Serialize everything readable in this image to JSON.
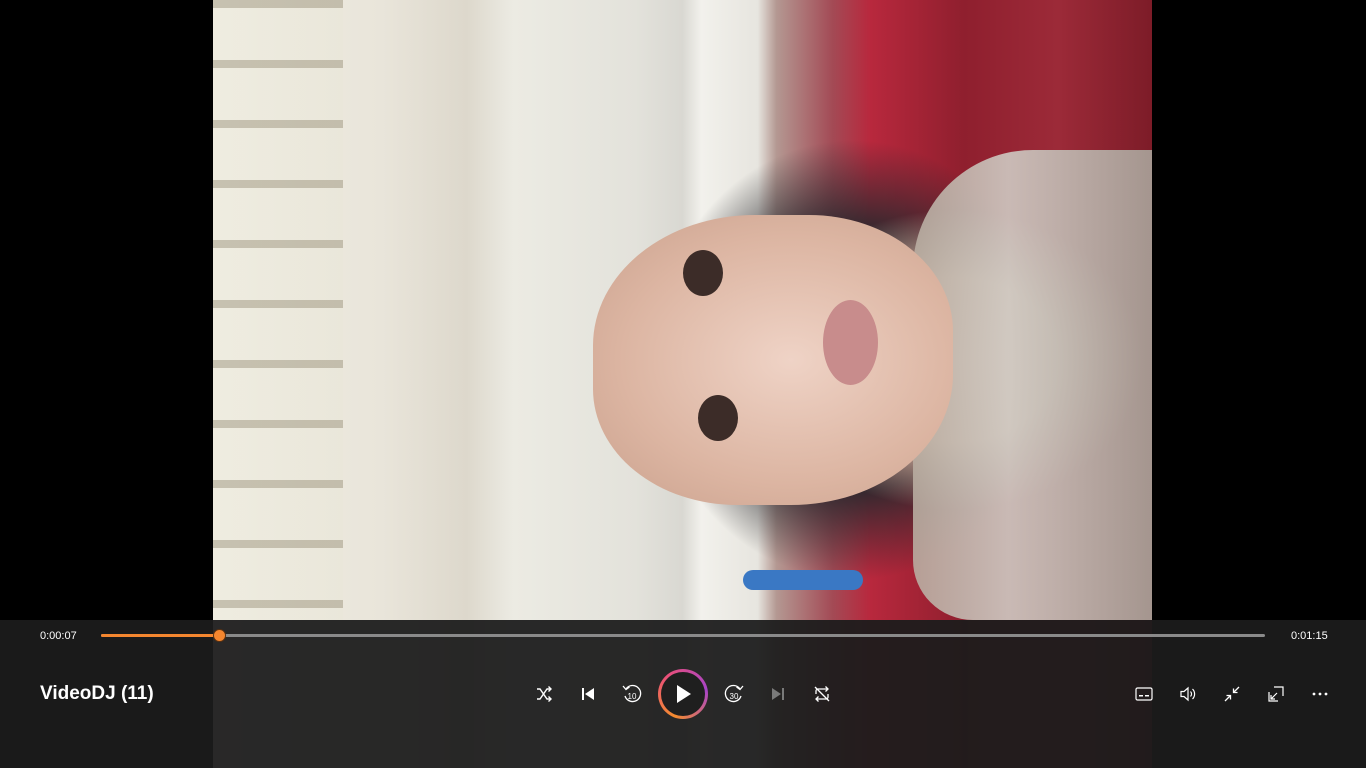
{
  "player": {
    "title": "VideoDJ (11)",
    "current_time": "0:00:07",
    "duration": "0:01:15",
    "progress_fraction": 0.101
  },
  "controls": {
    "skip_back_seconds": "10",
    "skip_forward_seconds": "30"
  },
  "icons": {
    "shuffle": "shuffle-icon",
    "previous": "previous-icon",
    "skip_back": "skip-back-10-icon",
    "play": "play-icon",
    "skip_forward": "skip-forward-30-icon",
    "next": "next-icon",
    "repeat": "repeat-off-icon",
    "captions": "captions-icon",
    "volume": "volume-icon",
    "exit_fullscreen": "exit-fullscreen-icon",
    "mini_player": "mini-player-icon",
    "more": "more-icon"
  },
  "colors": {
    "accent": "#f4862f",
    "control_bar": "#1c1c1c"
  }
}
